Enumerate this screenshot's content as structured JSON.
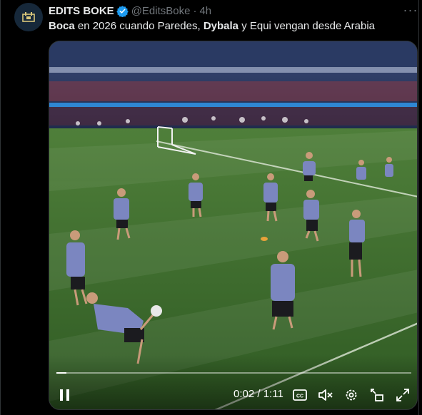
{
  "tweet": {
    "author_name": "EDITS BOKE",
    "handle": "@EditsBoke",
    "separator": "·",
    "time": "4h",
    "more_glyph": "···",
    "text_parts": [
      {
        "text": "Boca",
        "bold": true
      },
      {
        "text": " en 2026 cuando Paredes, ",
        "bold": false
      },
      {
        "text": "Dybala",
        "bold": true
      },
      {
        "text": " y Equi vengan desde Arabia",
        "bold": false
      }
    ]
  },
  "video": {
    "current_time": "0:02",
    "time_separator": " / ",
    "duration": "1:11",
    "progress": 0.028
  },
  "colors": {
    "background": "#000000",
    "text_primary": "#e7e9ea",
    "text_secondary": "#71767b",
    "verified": "#1d9bf0",
    "pitch": "#3c6a2c",
    "kit": "#7b86c0"
  },
  "icons": [
    "avatar-logo-icon",
    "verified-badge-icon",
    "more-options-icon",
    "pause-icon",
    "captions-icon",
    "volume-muted-icon",
    "settings-gear-icon",
    "pip-icon",
    "fullscreen-icon"
  ]
}
